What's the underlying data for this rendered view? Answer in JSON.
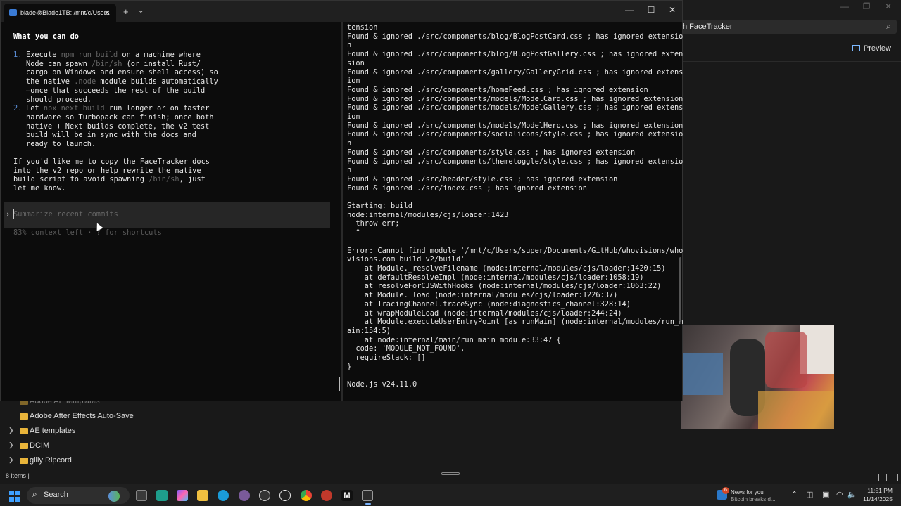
{
  "explorer": {
    "search_text": "h FaceTracker",
    "preview_label": "Preview",
    "nav_items": [
      {
        "label": "Adobe AE templates"
      },
      {
        "label": "Adobe After Effects Auto-Save"
      },
      {
        "label": "AE templates"
      },
      {
        "label": "DCIM"
      },
      {
        "label": "gilly Ripcord"
      }
    ],
    "status_text": "8 items  |"
  },
  "terminal": {
    "tab_title": "blade@Blade1TB: /mnt/c/Users",
    "left": {
      "heading": "What you can do",
      "items": [
        {
          "num": "1.",
          "lines": [
            [
              {
                "t": "Execute "
              },
              {
                "t": "npm run build",
                "dim": true
              },
              {
                "t": " on a machine where"
              }
            ],
            [
              {
                "t": "Node can spawn "
              },
              {
                "t": "/bin/sh",
                "dim": true
              },
              {
                "t": " (or install Rust/"
              }
            ],
            [
              {
                "t": "cargo on Windows and ensure shell access) so"
              }
            ],
            [
              {
                "t": "the native "
              },
              {
                "t": ".node",
                "dim": true
              },
              {
                "t": " module builds automatically"
              }
            ],
            [
              {
                "t": "—once that succeeds the rest of the build"
              }
            ],
            [
              {
                "t": "should proceed."
              }
            ]
          ]
        },
        {
          "num": "2.",
          "lines": [
            [
              {
                "t": "Let "
              },
              {
                "t": "npx next build",
                "dim": true
              },
              {
                "t": " run longer or on faster"
              }
            ],
            [
              {
                "t": "hardware so Turbopack can finish; once both"
              }
            ],
            [
              {
                "t": "native + Next builds complete, the v2 test"
              }
            ],
            [
              {
                "t": "build will be in sync with the docs and"
              }
            ],
            [
              {
                "t": "ready to launch."
              }
            ]
          ]
        }
      ],
      "para_lines": [
        [
          {
            "t": "If you'd like me to copy the FaceTracker docs"
          }
        ],
        [
          {
            "t": "into the v2 repo or help rewrite the native"
          }
        ],
        [
          {
            "t": "build script to avoid spawning "
          },
          {
            "t": "/bin/sh",
            "dim": true
          },
          {
            "t": ", just"
          }
        ],
        [
          {
            "t": "let me know."
          }
        ]
      ],
      "prompt_placeholder": "Summarize recent commits",
      "context_text": "83% context left · ? for shortcuts"
    },
    "right_lines": [
      "tension",
      "Found & ignored ./src/components/blog/BlogPostCard.css ; has ignored extensio",
      "n",
      "Found & ignored ./src/components/blog/BlogPostGallery.css ; has ignored exten",
      "sion",
      "Found & ignored ./src/components/gallery/GalleryGrid.css ; has ignored extens",
      "ion",
      "Found & ignored ./src/components/homeFeed.css ; has ignored extension",
      "Found & ignored ./src/components/models/ModelCard.css ; has ignored extension",
      "Found & ignored ./src/components/models/ModelGallery.css ; has ignored extens",
      "ion",
      "Found & ignored ./src/components/models/ModelHero.css ; has ignored extension",
      "Found & ignored ./src/components/socialicons/style.css ; has ignored extensio",
      "n",
      "Found & ignored ./src/components/style.css ; has ignored extension",
      "Found & ignored ./src/components/themetoggle/style.css ; has ignored extensio",
      "n",
      "Found & ignored ./src/header/style.css ; has ignored extension",
      "Found & ignored ./src/index.css ; has ignored extension",
      "",
      "Starting: build",
      "node:internal/modules/cjs/loader:1423",
      "  throw err;",
      "  ^",
      "",
      "Error: Cannot find module '/mnt/c/Users/super/Documents/GitHub/whovisions/who",
      "visions.com build v2/build'",
      "    at Module._resolveFilename (node:internal/modules/cjs/loader:1420:15)",
      "    at defaultResolveImpl (node:internal/modules/cjs/loader:1058:19)",
      "    at resolveForCJSWithHooks (node:internal/modules/cjs/loader:1063:22)",
      "    at Module._load (node:internal/modules/cjs/loader:1226:37)",
      "    at TracingChannel.traceSync (node:diagnostics_channel:328:14)",
      "    at wrapModuleLoad (node:internal/modules/cjs/loader:244:24)",
      "    at Module.executeUserEntryPoint [as runMain] (node:internal/modules/run_m",
      "ain:154:5)",
      "    at node:internal/main/run_main_module:33:47 {",
      "  code: 'MODULE_NOT_FOUND',",
      "  requireStack: []",
      "}",
      "",
      "Node.js v24.11.0"
    ]
  },
  "taskbar": {
    "search_label": "Search",
    "news_title": "News for you",
    "news_sub": "Bitcoin breaks d...",
    "news_badge": "6",
    "time": "11:51 PM",
    "date": "11/14/2025"
  },
  "colors": {
    "accent": "#3ea0ff",
    "terminal_bg": "#0c0c0c",
    "dim_text": "#666666"
  }
}
